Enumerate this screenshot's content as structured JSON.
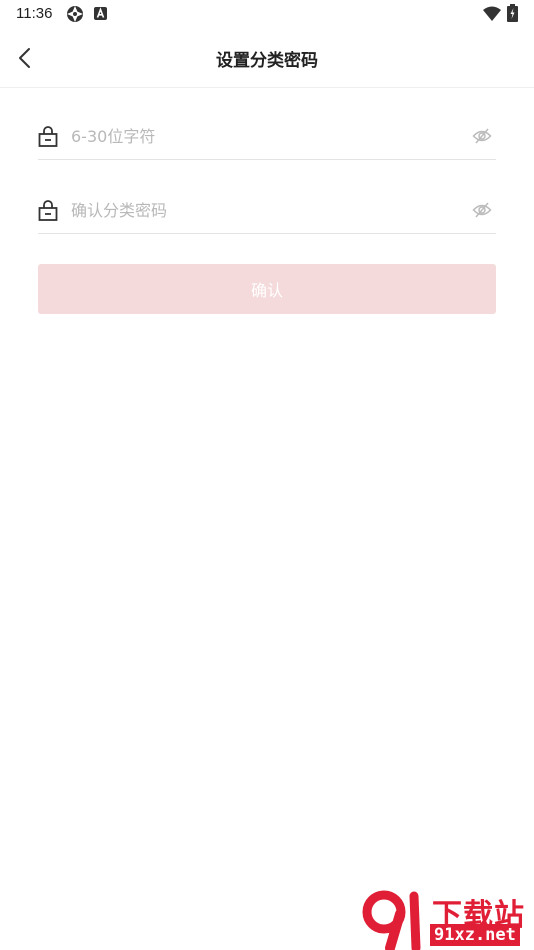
{
  "status_bar": {
    "time": "11:36",
    "icons": [
      "aperture-icon",
      "a-badge-icon",
      "wifi-icon",
      "battery-charging-icon"
    ]
  },
  "header": {
    "title": "设置分类密码",
    "back_icon": "chevron-left-icon"
  },
  "form": {
    "password": {
      "placeholder": "6-30位字符",
      "value": "",
      "icon": "lock-icon",
      "toggle_icon": "eye-off-icon"
    },
    "confirm_password": {
      "placeholder": "确认分类密码",
      "value": "",
      "icon": "lock-icon",
      "toggle_icon": "eye-off-icon"
    },
    "submit_label": "确认",
    "submit_color": "#f4dadb"
  },
  "watermark": {
    "title": "下载站",
    "domain": "91xz.net",
    "color": "#e01e35"
  }
}
